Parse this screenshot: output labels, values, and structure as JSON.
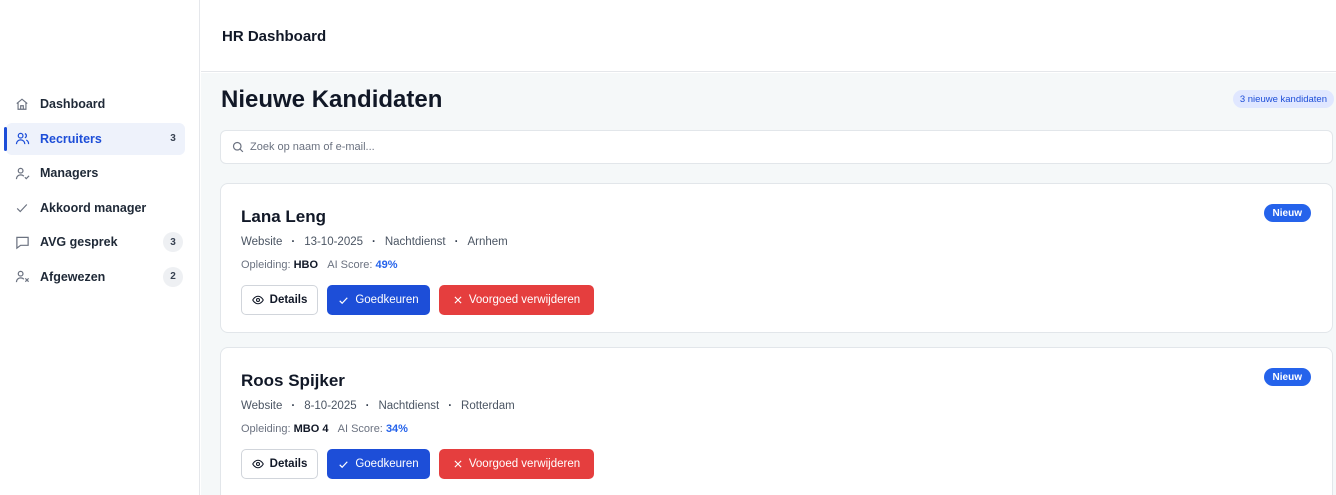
{
  "header": {
    "title": "HR Dashboard"
  },
  "sidebar": {
    "items": [
      {
        "label": "Dashboard",
        "icon": "home-icon",
        "count": "",
        "active": false
      },
      {
        "label": "Recruiters",
        "icon": "users-icon",
        "count": "3",
        "active": true
      },
      {
        "label": "Managers",
        "icon": "user-check-icon",
        "count": "",
        "active": false
      },
      {
        "label": "Akkoord manager",
        "icon": "check-icon",
        "count": "",
        "active": false
      },
      {
        "label": "AVG gesprek",
        "icon": "chat-icon",
        "count": "3",
        "active": false
      },
      {
        "label": "Afgewezen",
        "icon": "user-x-icon",
        "count": "2",
        "active": false
      }
    ]
  },
  "main": {
    "title": "Nieuwe Kandidaten",
    "badge": "3 nieuwe kandidaten",
    "search": {
      "placeholder": "Zoek op naam of e-mail...",
      "value": ""
    }
  },
  "labels": {
    "education": "Opleiding:",
    "ai_score": "AI Score:",
    "details": "Details",
    "approve": "Goedkeuren",
    "delete": "Voorgoed verwijderen",
    "new": "Nieuw"
  },
  "candidates": [
    {
      "name": "Lana Leng",
      "source": "Website",
      "date": "13-10-2025",
      "shift": "Nachtdienst",
      "city": "Arnhem",
      "education": "HBO",
      "score": "49%"
    },
    {
      "name": "Roos Spijker",
      "source": "Website",
      "date": "8-10-2025",
      "shift": "Nachtdienst",
      "city": "Rotterdam",
      "education": "MBO 4",
      "score": "34%"
    }
  ],
  "colors": {
    "primary": "#1d4ed8",
    "danger": "#e53e3e",
    "accent_text": "#2563eb"
  }
}
